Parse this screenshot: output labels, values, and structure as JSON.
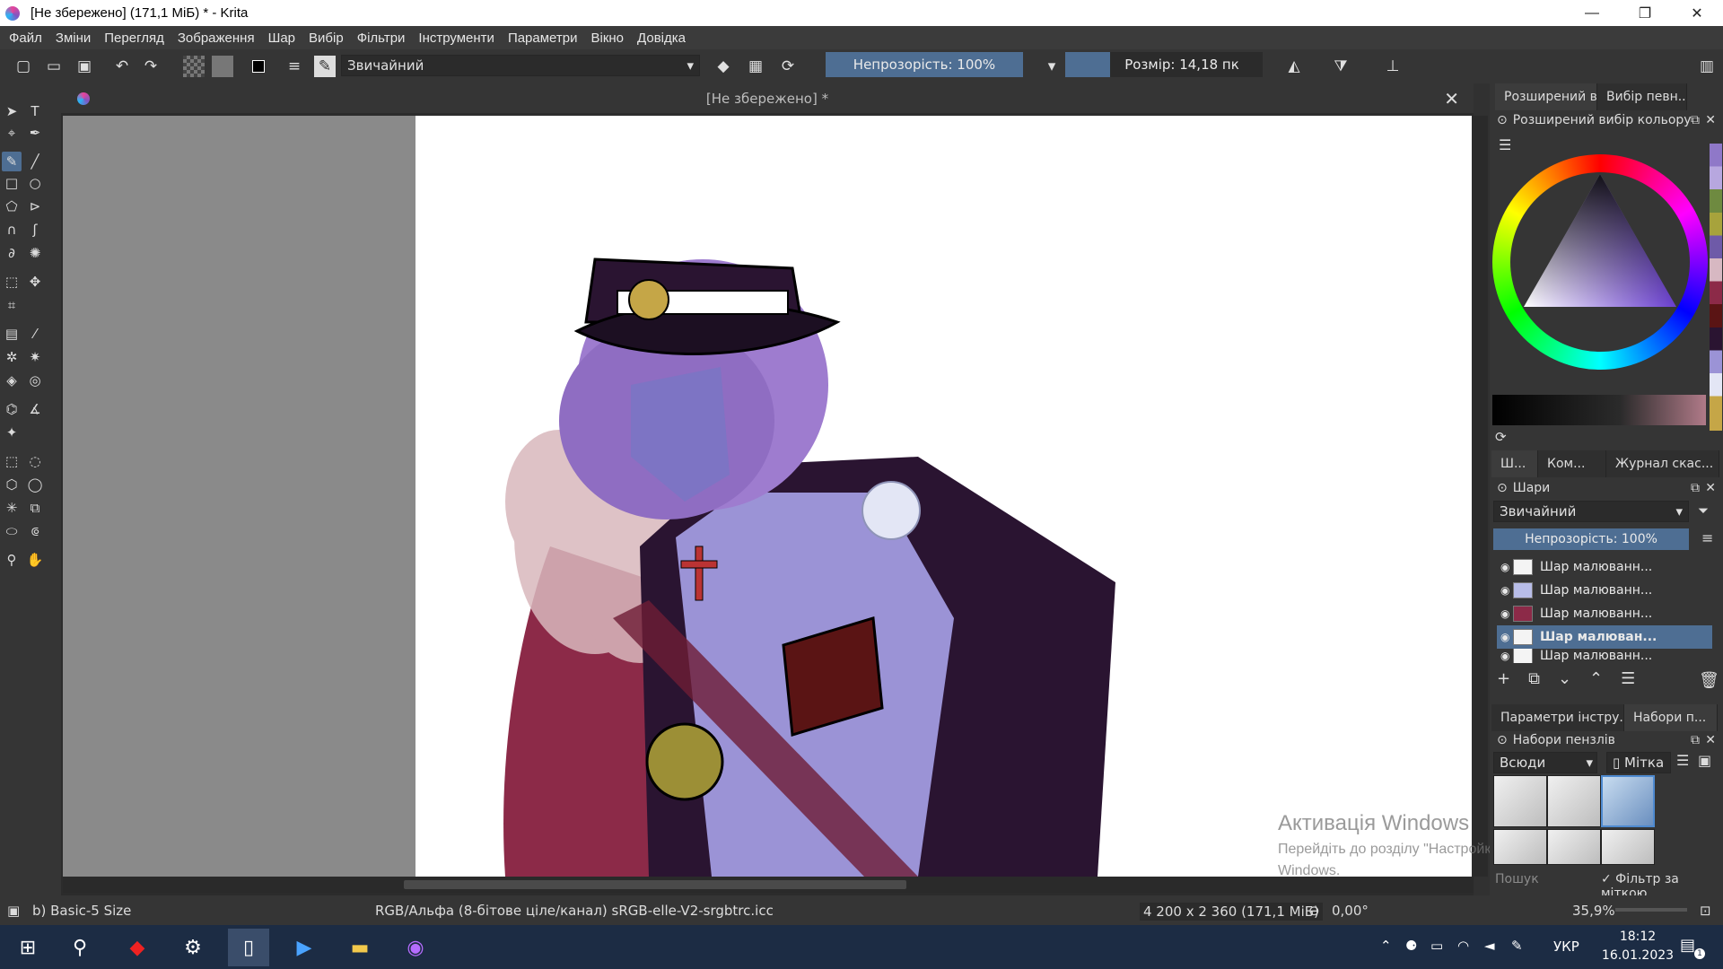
{
  "window": {
    "title": "[Не збережено]  (171,1 МіБ)  * - Krita",
    "minimize": "—",
    "maximize": "❐",
    "close": "✕"
  },
  "menu": [
    "Файл",
    "Зміни",
    "Перегляд",
    "Зображення",
    "Шар",
    "Вибір",
    "Фільтри",
    "Інструменти",
    "Параметри",
    "Вікно",
    "Довідка"
  ],
  "toolbar": {
    "blend_mode": "Звичайний",
    "opacity": "Непрозорість: 100%",
    "size": "Розмір: 14,18 пк"
  },
  "document": {
    "tab_title": "[Не збережено]  *"
  },
  "docker": {
    "top_tabs": [
      "Розширений ви...",
      "Вибір певн..."
    ],
    "color_title": "Розширений вибір кольору",
    "layer_tabs": [
      "Ш...",
      "Ком...",
      "Журнал скас..."
    ],
    "layers_title": "Шари",
    "layer_blend": "Звичайний",
    "layer_opacity": "Непрозорість:  100%",
    "layers": [
      "Шар малюванн...",
      "Шар малюванн...",
      "Шар малюванн...",
      "Шар малюван...",
      "Шар малюванн..."
    ],
    "bottom_tabs": [
      "Параметри інстру...",
      "Набори п..."
    ],
    "presets_title": "Набори пензлів",
    "preset_filter": "Всюди",
    "tag": "Мітка",
    "search_placeholder": "Пошук",
    "filter_by_tag": "✓ Фільтр за міткою"
  },
  "status": {
    "brush": "b) Basic-5 Size",
    "color_space": "RGB/Альфа (8-бітове ціле/канал)  sRGB-elle-V2-srgbtrc.icc",
    "dimensions": "4 200 x 2 360 (171,1 МіБ)",
    "rotation": "0,00°",
    "zoom": "35,9%"
  },
  "watermark": {
    "line1": "Активація Windows",
    "line2": "Перейдіть до розділу \"Настройки\", щоб активувати",
    "line3": "Windows."
  },
  "taskbar": {
    "lang": "УКР",
    "time": "18:12",
    "date": "16.01.2023",
    "notif": "1"
  }
}
